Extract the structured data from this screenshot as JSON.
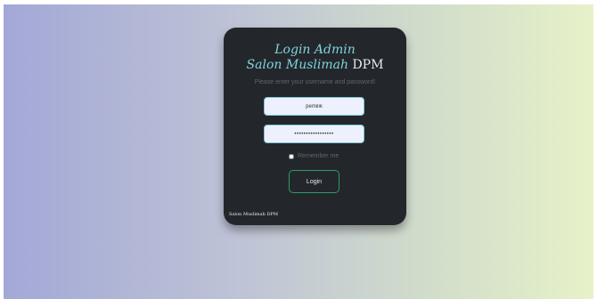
{
  "login": {
    "title_line1": "Login Admin",
    "title_line2_accent": "Salon Muslimah",
    "title_line2_plain": " DPM",
    "subtitle": "Please enter your username and password!",
    "username_value": "pemilik",
    "password_value": "•••••••••••••••••",
    "remember_label": "Remember me",
    "login_button": "Login",
    "footer_text": "Salon Muslimah DPM"
  },
  "colors": {
    "accent": "#7fd3dc",
    "card_background": "#23272b",
    "button_border": "#2f9a6a",
    "input_border": "#7fc4d6",
    "gradient_left": "#a3a8d7",
    "gradient_right": "#e7f1c9"
  }
}
